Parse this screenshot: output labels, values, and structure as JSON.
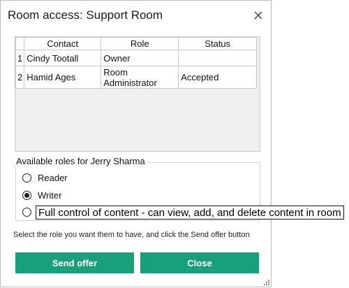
{
  "dialog": {
    "title": "Room access: Support Room",
    "close_icon": "close-icon"
  },
  "table": {
    "columns": [
      "Contact",
      "Role",
      "Status"
    ],
    "rows": [
      {
        "index": "1",
        "contact": "Cindy Tootall",
        "role": "Owner",
        "status": ""
      },
      {
        "index": "2",
        "contact": "Hamid Ages",
        "role": "Room Administrator",
        "status": "Accepted"
      }
    ]
  },
  "roles": {
    "group_label": "Available roles for Jerry Sharma",
    "options": [
      {
        "label": "Reader",
        "selected": false
      },
      {
        "label": "Writer",
        "selected": true
      },
      {
        "label": "",
        "selected": false
      }
    ],
    "tooltip": "Full control of content - can view, add, and delete content in room"
  },
  "hint": "Select the role you want them to have, and click the Send offer button",
  "buttons": {
    "send": "Send offer",
    "close": "Close"
  },
  "colors": {
    "accent": "#18a07a"
  }
}
